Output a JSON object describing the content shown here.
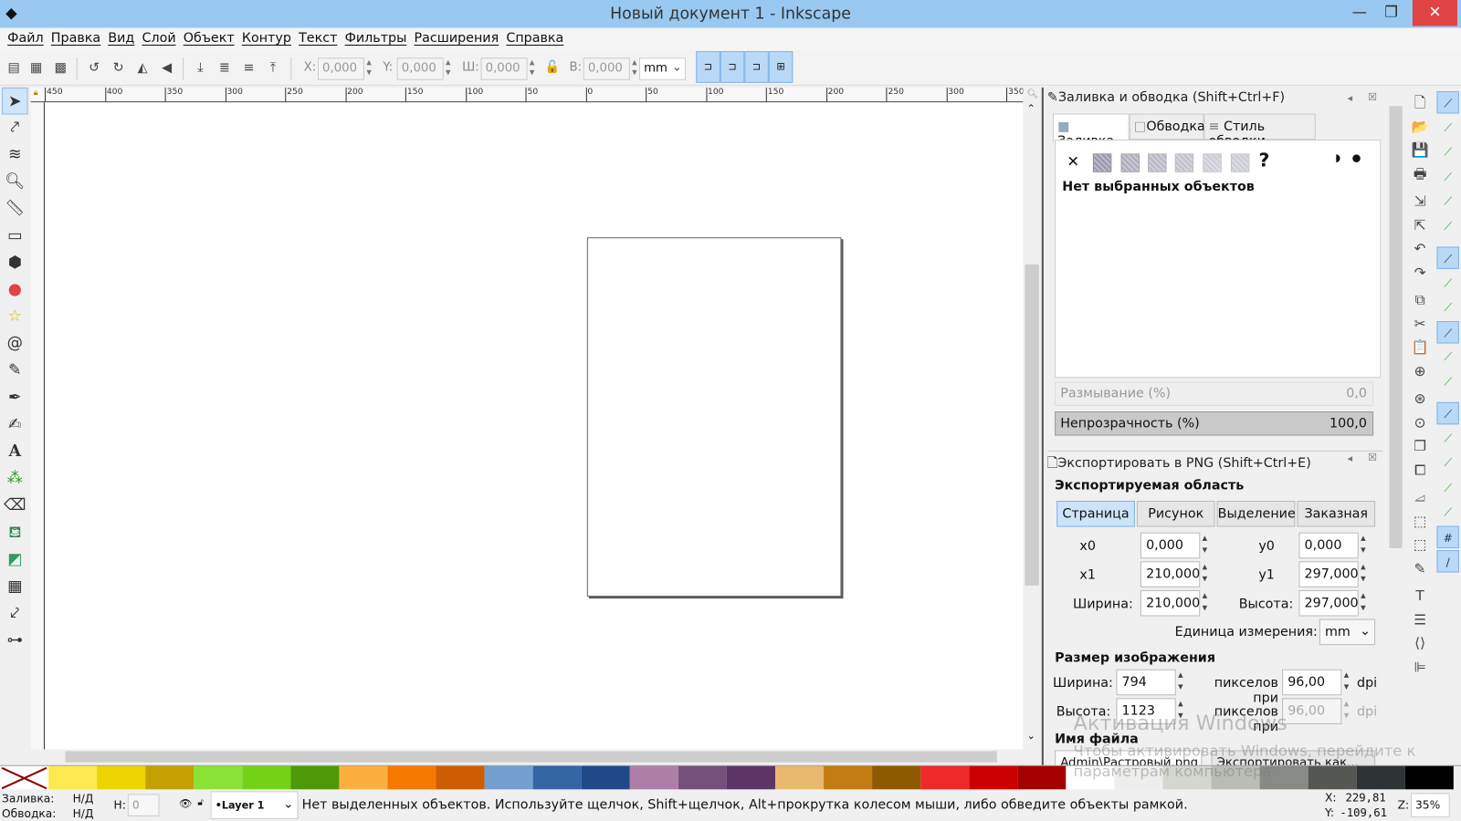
{
  "window": {
    "title": "Новый документ 1 - Inkscape",
    "buttons": [
      "minimize",
      "maximize",
      "close"
    ]
  },
  "menu": [
    "Файл",
    "Правка",
    "Вид",
    "Слой",
    "Объект",
    "Контур",
    "Текст",
    "Фильтры",
    "Расширения",
    "Справка"
  ],
  "toolbar": {
    "x_label": "X:",
    "x": "0,000",
    "y_label": "Y:",
    "y": "0,000",
    "w_label": "Ш:",
    "w": "0,000",
    "h_label": "В:",
    "h": "0,000",
    "unit": "mm"
  },
  "ruler": [
    "450",
    "400",
    "350",
    "300",
    "250",
    "200",
    "150",
    "100",
    "50",
    "0",
    "50",
    "100",
    "150",
    "200",
    "250",
    "300",
    "350"
  ],
  "tools": [
    "selector",
    "node",
    "tweak",
    "zoom",
    "measure",
    "rectangle",
    "3d-box",
    "ellipse",
    "star",
    "spiral",
    "pencil",
    "pen",
    "calligraphy",
    "text",
    "spray",
    "eraser",
    "paint-bucket",
    "gradient",
    "mesh",
    "dropper",
    "connector"
  ],
  "fill_stroke": {
    "title": "Заливка и обводка (Shift+Ctrl+F)",
    "tabs": [
      "Заливка",
      "Обводка",
      "Стиль обводки"
    ],
    "no_selection": "Нет выбранных объектов",
    "blur_label": "Размывание (%)",
    "blur": "0,0",
    "opacity_label": "Непрозрачность (%)",
    "opacity": "100,0",
    "opacity_value": 100
  },
  "export": {
    "title": "Экспортировать в PNG (Shift+Ctrl+E)",
    "area_heading": "Экспортируемая область",
    "area_buttons": [
      "Страница",
      "Рисунок",
      "Выделение",
      "Заказная"
    ],
    "x0_label": "x0",
    "x0": "0,000",
    "y0_label": "y0",
    "y0": "0,000",
    "x1_label": "x1",
    "x1": "210,000",
    "y1_label": "y1",
    "y1": "297,000",
    "width_label": "Ширина:",
    "width": "210,000",
    "height_label": "Высота:",
    "height": "297,000",
    "unit_label": "Единица измерения:",
    "unit": "mm",
    "size_heading": "Размер изображения",
    "img_width_label": "Ширина:",
    "img_width": "794",
    "img_height_label": "Высота:",
    "img_height": "1123",
    "px_at": "пикселов при",
    "dpi_x": "96,00",
    "dpi_y": "96,00",
    "dpi": "dpi",
    "filename_heading": "Имя файла",
    "filename": "Admin\\Растровый.png",
    "export_as": "Экспортировать как..."
  },
  "watermark": {
    "line1": "Активация Windows",
    "line2": "Чтобы активировать Windows, перейдите к",
    "line3": "параметрам компьютера."
  },
  "palette": [
    "#fce94f",
    "#edd400",
    "#c4a000",
    "#8ae234",
    "#73d216",
    "#4e9a06",
    "#fcaf3e",
    "#f57900",
    "#ce5c00",
    "#729fcf",
    "#3465a4",
    "#204a87",
    "#ad7fa8",
    "#75507b",
    "#5c3566",
    "#e9b96e",
    "#c17d11",
    "#8f5902",
    "#ef2929",
    "#cc0000",
    "#a40000",
    "#ffffff",
    "#eeeeec",
    "#d3d7cf",
    "#babdb6",
    "#888a85",
    "#555753",
    "#2e3436",
    "#000000"
  ],
  "status": {
    "fill_label": "Заливка:",
    "fill": "Н/Д",
    "stroke_label": "Обводка:",
    "stroke": "Н/Д",
    "h_label": "Н:",
    "h": "0",
    "layer": "•Layer 1",
    "message": "Нет выделенных объектов. Используйте щелчок, Shift+щелчок, Alt+прокрутка колесом мыши, либо обведите объекты рамкой.",
    "x_label": "X:",
    "x": "229,81",
    "y_label": "Y:",
    "y": "-109,61",
    "zoom_label": "Z:",
    "zoom": "35%"
  }
}
